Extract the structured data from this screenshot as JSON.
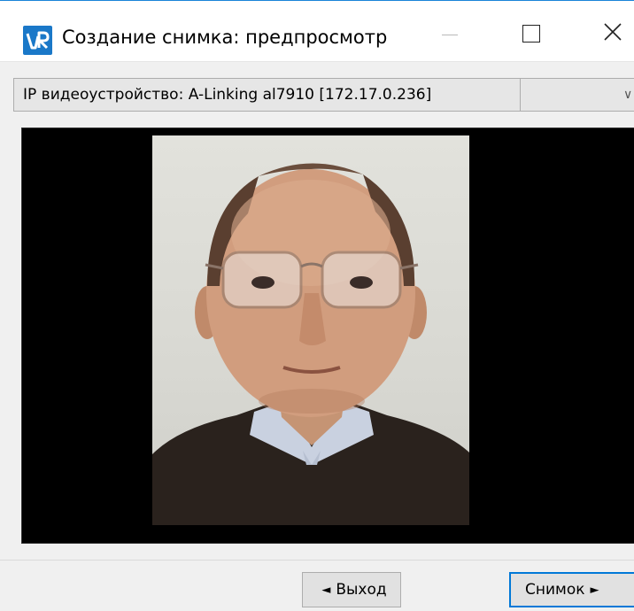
{
  "window": {
    "title": "Создание снимка: предпросмотр",
    "app_icon": "vr-logo-icon",
    "controls": {
      "minimize": "minimize-icon",
      "maximize": "maximize-icon",
      "close": "close-icon"
    }
  },
  "device_selector": {
    "selected": "IP видеоустройство: A-Linking al7910 [172.17.0.236]",
    "dropdown_icon": "chevron-down-icon"
  },
  "preview": {
    "content": "camera-preview-photo"
  },
  "buttons": {
    "exit_label": "Выход",
    "exit_arrow": "◄",
    "snapshot_label": "Снимок",
    "snapshot_arrow": "►"
  },
  "colors": {
    "accent": "#0078d7",
    "title_line": "#1a84d8",
    "preview_bg": "#000000",
    "window_bg": "#f0f0f0"
  }
}
